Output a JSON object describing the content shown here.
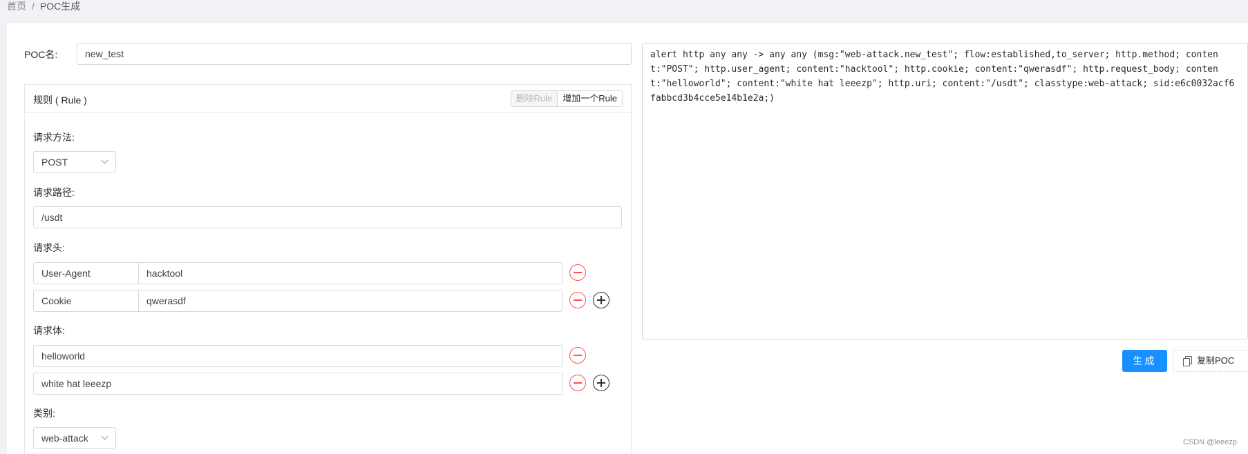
{
  "breadcrumb": {
    "home": "首页",
    "separator": "/",
    "current": "POC生成"
  },
  "poc": {
    "label": "POC名:",
    "name_value": "new_test"
  },
  "rule": {
    "title": "规则 ( Rule )",
    "delete_label": "删除Rule",
    "add_label": "增加一个Rule",
    "method_label": "请求方法:",
    "method_value": "POST",
    "path_label": "请求路径:",
    "path_value": "/usdt",
    "headers_label": "请求头:",
    "headers": [
      {
        "key": "User-Agent",
        "value": "hacktool"
      },
      {
        "key": "Cookie",
        "value": "qwerasdf"
      }
    ],
    "body_label": "请求体:",
    "body": [
      "helloworld",
      "white hat leeezp"
    ],
    "category_label": "类别:",
    "category_value": "web-attack"
  },
  "output": {
    "text": "alert http any any -> any any (msg:\"web-attack.new_test\"; flow:established,to_server; http.method; content:\"POST\"; http.user_agent; content:\"hacktool\"; http.cookie; content:\"qwerasdf\"; http.request_body; content:\"helloworld\"; content:\"white hat leeezp\"; http.uri; content:\"/usdt\"; classtype:web-attack; sid:e6c0032acf6fabbcd3b4cce5e14b1e2a;)"
  },
  "actions": {
    "generate_label": "生成",
    "copy_label": "复制POC"
  },
  "watermark": "CSDN @leeezp",
  "colors": {
    "primary": "#1890ff",
    "danger": "#ff4d4f",
    "background": "#f0f2f5"
  }
}
